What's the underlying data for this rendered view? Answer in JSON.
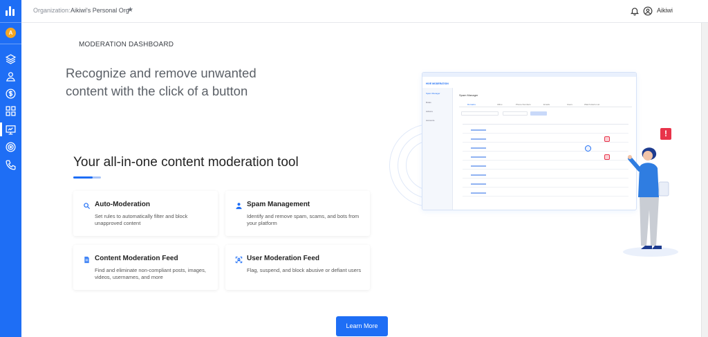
{
  "header": {
    "org_label": "Organization:",
    "org_name": "Aikiwi's Personal Org",
    "user_name": "Aikiwi"
  },
  "sidebar": {
    "avatar_initial": "A",
    "items": [
      "layers-icon",
      "user-icon",
      "billing-icon",
      "apps-icon",
      "moderation-icon",
      "target-icon",
      "phone-icon"
    ],
    "active_index": 4
  },
  "main": {
    "section_title": "MODERATION DASHBOARD",
    "hero_text": "Recognize and remove unwanted content with the click of a button",
    "subheading": "Your all-in-one content moderation tool",
    "features": [
      {
        "title": "Auto-Moderation",
        "desc": "Set rules to automatically filter and block unapproved content"
      },
      {
        "title": "Spam Management",
        "desc": "Identify and remove spam, scams, and bots from your platform"
      },
      {
        "title": "Content Moderation Feed",
        "desc": "Find and eliminate non-compliant posts, images, videos, usernames, and more"
      },
      {
        "title": "User Moderation Feed",
        "desc": "Flag, suspend, and block abusive or defiant users"
      }
    ],
    "learn_more": "Learn More"
  },
  "illustration": {
    "app_title": "HIVE MODERATION",
    "sidebar_items": [
      "Spam Manager",
      "Rules",
      "Actions",
      "Accounts"
    ],
    "page_heading": "Spam Manager",
    "tabs": [
      "Domains",
      "URLs",
      "Phone Numbers",
      "Emails",
      "Users",
      "Watch Alerts List"
    ]
  },
  "colors": {
    "brand": "#1e6ef5",
    "avatar": "#f5a623",
    "alert": "#e8334a"
  }
}
